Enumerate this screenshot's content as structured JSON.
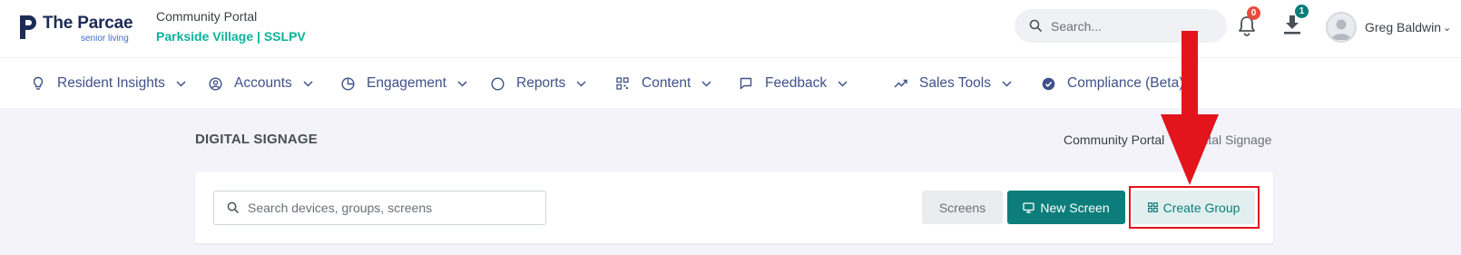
{
  "header": {
    "logo_name": "The Parcae",
    "logo_subtitle": "senior living",
    "community_label": "Community Portal",
    "community_name": "Parkside Village | SSLPV",
    "search_placeholder": "Search...",
    "notifications_count": "0",
    "downloads_count": "1",
    "user_name": "Greg Baldwin",
    "user_chevron": "⌄"
  },
  "nav": {
    "items": [
      {
        "label": "Resident Insights",
        "icon": "lightbulb-icon",
        "has_dropdown": true
      },
      {
        "label": "Accounts",
        "icon": "user-circle-icon",
        "has_dropdown": true
      },
      {
        "label": "Engagement",
        "icon": "pie-chart-icon",
        "has_dropdown": true
      },
      {
        "label": "Reports",
        "icon": "circle-icon",
        "has_dropdown": true
      },
      {
        "label": "Content",
        "icon": "qr-code-icon",
        "has_dropdown": true
      },
      {
        "label": "Feedback",
        "icon": "message-square-icon",
        "has_dropdown": true
      },
      {
        "label": "Sales Tools",
        "icon": "trending-up-icon",
        "has_dropdown": true
      },
      {
        "label": "Compliance (Beta)",
        "icon": "check-badge-icon",
        "has_dropdown": false
      }
    ]
  },
  "page": {
    "title": "DIGITAL SIGNAGE",
    "breadcrumb": [
      "Community Portal",
      "Digital Signage"
    ],
    "breadcrumb_separator": ">"
  },
  "toolbar": {
    "search_placeholder": "Search devices, groups, screens",
    "screens_label": "Screens",
    "new_screen_label": "New Screen",
    "create_group_label": "Create Group"
  },
  "colors": {
    "brand_navy": "#1d2b57",
    "nav_text": "#405189",
    "community_green": "#0ab39c",
    "primary_teal": "#0c7d7a",
    "notification_red": "#e74c3c",
    "annotation_red": "#e3141c",
    "page_background": "#f3f3f9"
  }
}
